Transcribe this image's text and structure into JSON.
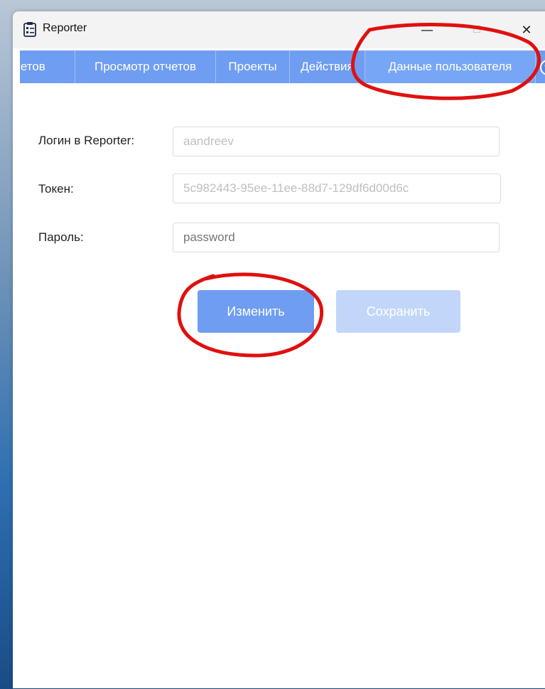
{
  "window": {
    "title": "Reporter",
    "minimize_glyph": "—",
    "maximize_glyph": "☐",
    "close_glyph": "✕"
  },
  "tabs": [
    {
      "label": "четов",
      "active": false
    },
    {
      "label": "Просмотр отчетов",
      "active": false
    },
    {
      "label": "Проекты",
      "active": false
    },
    {
      "label": "Действия",
      "active": false
    },
    {
      "label": "Данные пользователя",
      "active": true
    }
  ],
  "form": {
    "login_label": "Логин в Reporter:",
    "login_value": "aandreev",
    "token_label": "Токен:",
    "token_value": "5c982443-95ee-11ee-88d7-129df6d00d6c",
    "password_label": "Пароль:",
    "password_placeholder": "password"
  },
  "buttons": {
    "edit_label": "Изменить",
    "save_label": "Сохранить"
  },
  "colors": {
    "accent": "#6f9df2",
    "accent_disabled": "#c2d6fa",
    "annotation": "#e01010"
  },
  "icons": {
    "app": "clipboard-icon",
    "tab_scroll": "chevron-down-icon"
  }
}
